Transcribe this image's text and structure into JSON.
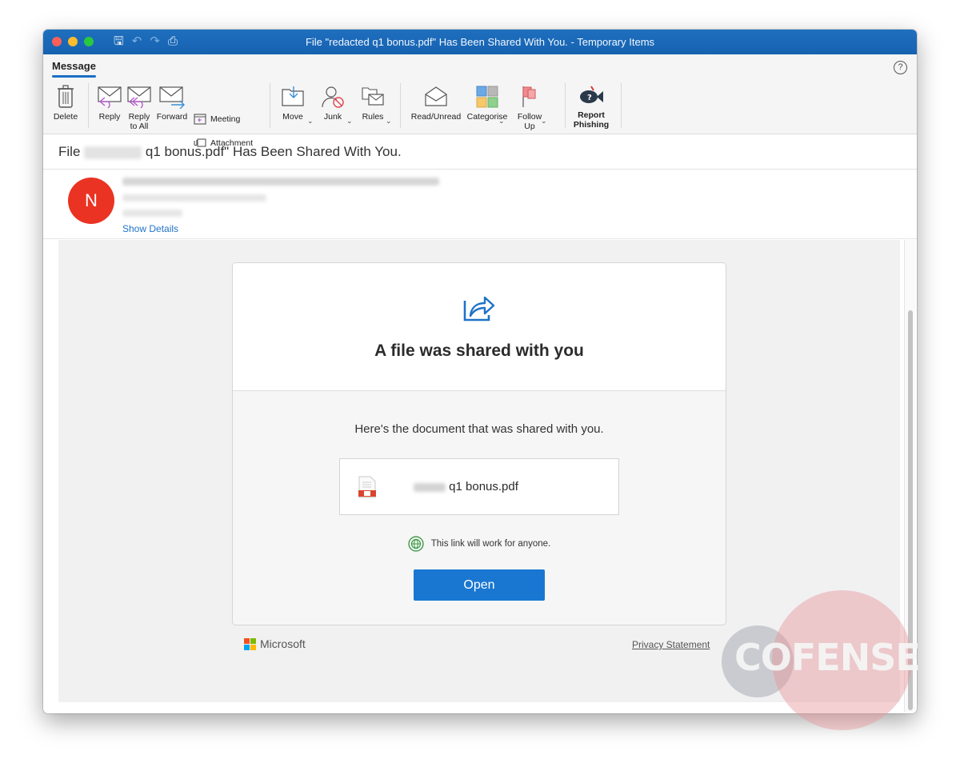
{
  "window": {
    "title": "File \"redacted q1 bonus.pdf\" Has Been Shared With You. - Temporary Items",
    "toolbar_icons": [
      "save-icon",
      "undo-icon",
      "redo-icon",
      "print-icon"
    ]
  },
  "ribbon": {
    "active_tab": "Message",
    "help": "?",
    "buttons": {
      "delete": "Delete",
      "reply": "Reply",
      "reply_all_1": "Reply",
      "reply_all_2": "to All",
      "forward": "Forward",
      "meeting": "Meeting",
      "attachment": "Attachment",
      "move": "Move",
      "junk": "Junk",
      "rules": "Rules",
      "read_unread": "Read/Unread",
      "categorise": "Categorise",
      "follow_up_1": "Follow",
      "follow_up_2": "Up",
      "report_1": "Report",
      "report_2": "Phishing"
    }
  },
  "message": {
    "subject_prefix": "File",
    "subject_suffix": "q1 bonus.pdf\" Has Been Shared With You.",
    "avatar_initial": "N",
    "show_details": "Show Details"
  },
  "email_body": {
    "title": "A file was shared with you",
    "subtitle": "Here's the document that was shared with you.",
    "file_name": "q1 bonus.pdf",
    "link_note": "This link will work for anyone.",
    "open_button": "Open",
    "brand": "Microsoft",
    "privacy": "Privacy Statement"
  },
  "watermark": {
    "text": "COFENSE"
  },
  "colors": {
    "accent": "#1977d2",
    "titlebar": "#1a68b8",
    "avatar": "#ea3323"
  }
}
